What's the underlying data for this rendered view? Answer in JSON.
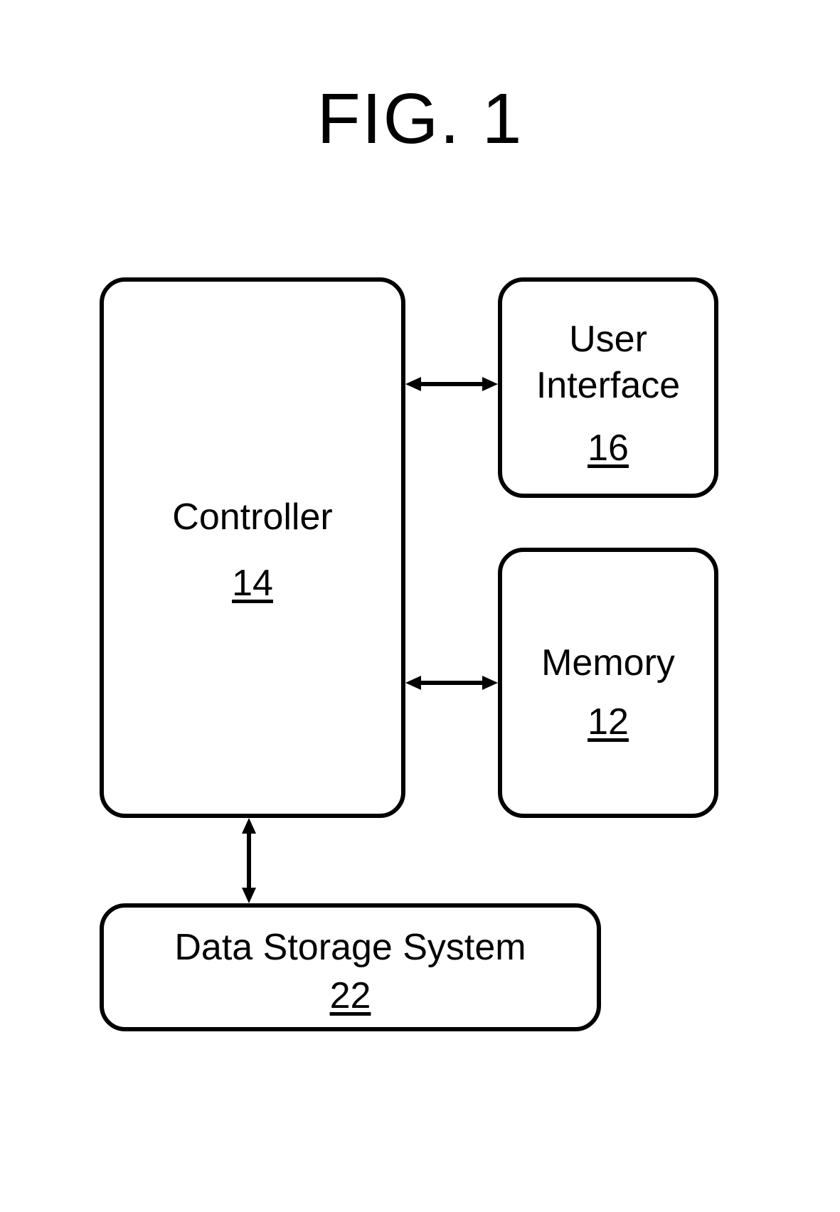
{
  "figure": {
    "title": "FIG. 1"
  },
  "blocks": {
    "controller": {
      "label": "Controller",
      "ref": "14"
    },
    "user_interface": {
      "label_line1": "User",
      "label_line2": "Interface",
      "ref": "16"
    },
    "memory": {
      "label": "Memory",
      "ref": "12"
    },
    "data_storage": {
      "label": "Data Storage System",
      "ref": "22"
    }
  }
}
